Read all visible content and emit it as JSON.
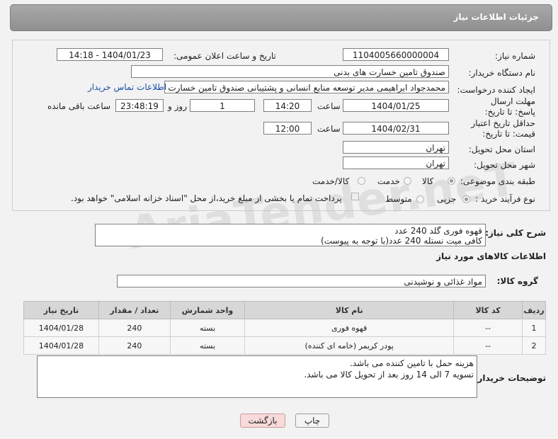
{
  "header": {
    "title": "جزئیات اطلاعات نیاز"
  },
  "form": {
    "need_number_label": "شماره نیاز:",
    "need_number": "1104005660000004",
    "announce_label": "تاریخ و ساعت اعلان عمومی:",
    "announce_value": "1404/01/23 - 14:18",
    "buyer_org_label": "نام دستگاه خریدار:",
    "buyer_org": "صندوق تامین خسارت های بدنی",
    "requester_label": "ایجاد کننده درخواست:",
    "requester": "محمدجواد ابراهیمی مدیر توسعه منابع انسانی و پشتیبانی صندوق تامین خسارت",
    "buyer_contact_link": "اطلاعات تماس خریدار",
    "deadline_label": "مهلت ارسال پاسخ: تا تاریخ:",
    "deadline_date": "1404/01/25",
    "time_label": "ساعت",
    "deadline_time": "14:20",
    "days_count": "1",
    "days_label": "روز و",
    "remaining_time": "23:48:19",
    "remaining_label": "ساعت باقی مانده",
    "price_valid_label": "حداقل تاریخ اعتبار قیمت: تا تاریخ:",
    "price_valid_date": "1404/02/31",
    "price_valid_time": "12:00",
    "province_label": "استان محل تحویل:",
    "province": "تهران",
    "city_label": "شهر محل تحویل:",
    "city": "تهران",
    "category_label": "طبقه بندی موضوعی:",
    "category_options": [
      "کالا",
      "خدمت",
      "کالا/خدمت"
    ],
    "process_label": "نوع فرآیند خرید :",
    "process_options": [
      "جزیی",
      "متوسط"
    ],
    "payment_note": "پرداخت تمام یا بخشی از مبلغ خرید،از محل \"اسناد خزانه اسلامی\" خواهد بود."
  },
  "summary": {
    "label": "شرح کلی نیاز:",
    "line1": "قهوه فوری گلد 240 عدد",
    "line2": "کافی میت نستله 240 عدد(با توجه به پیوست)"
  },
  "goods_section": {
    "title": "اطلاعات کالاهای مورد نیاز",
    "group_label": "گروه کالا:",
    "group_value": "مواد غذائی و نوشیدنی"
  },
  "table": {
    "headers": [
      "ردیف",
      "کد کالا",
      "نام کالا",
      "واحد شمارش",
      "تعداد / مقدار",
      "تاریخ نیاز"
    ],
    "rows": [
      [
        "1",
        "--",
        "قهوه فوری",
        "بسته",
        "240",
        "1404/01/28"
      ],
      [
        "2",
        "--",
        "پودر کریمر (خامه ای کننده)",
        "بسته",
        "240",
        "1404/01/28"
      ]
    ]
  },
  "buyer_notes": {
    "label": "توضیحات خریدار:",
    "line1": "هزینه حمل با تامین کننده می باشد.",
    "line2": "تسویه 7 الی 14 روز بعد از تحویل کالا می باشد."
  },
  "buttons": {
    "print": "چاپ",
    "back": "بازگشت"
  },
  "watermark": "AriaTender.neT"
}
